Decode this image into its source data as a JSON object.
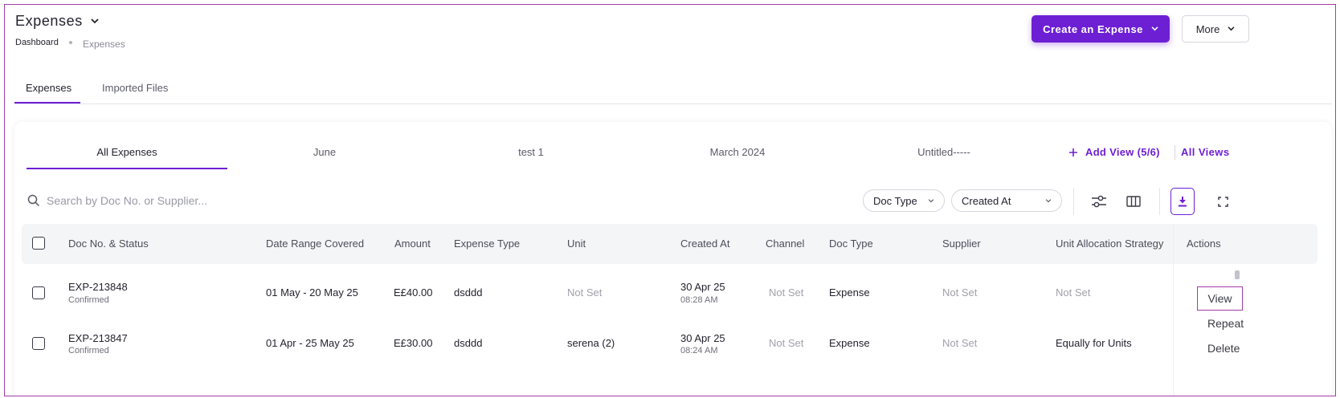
{
  "header": {
    "title": "Expenses",
    "breadcrumb": [
      "Dashboard",
      "Expenses"
    ],
    "create_button": "Create an Expense",
    "more_button": "More"
  },
  "tabs": [
    "Expenses",
    "Imported Files"
  ],
  "views": {
    "items": [
      "All Expenses",
      "June",
      "test 1",
      "March 2024",
      "Untitled-----"
    ],
    "add_view": "Add View (5/6)",
    "all_views": "All Views"
  },
  "search": {
    "placeholder": "Search by Doc No. or Supplier..."
  },
  "filters": {
    "doc_type": "Doc Type",
    "created_at": "Created At"
  },
  "colors": {
    "accent": "#6d1fd4",
    "highlight_border": "#a23ca8"
  },
  "table": {
    "columns": [
      "Doc No. & Status",
      "Date Range Covered",
      "Amount",
      "Expense Type",
      "Unit",
      "Created At",
      "Channel",
      "Doc Type",
      "Supplier",
      "Unit Allocation Strategy",
      "Actions"
    ],
    "rows": [
      {
        "doc_no": "EXP-213848",
        "status": "Confirmed",
        "date_range": "01 May - 20 May 25",
        "amount": "E£40.00",
        "expense_type": "dsddd",
        "unit": "Not Set",
        "created_date": "30 Apr 25",
        "created_time": "08:28 AM",
        "channel": "Not Set",
        "doc_type": "Expense",
        "supplier": "Not Set",
        "allocation": "Not Set"
      },
      {
        "doc_no": "EXP-213847",
        "status": "Confirmed",
        "date_range": "01 Apr - 25 May 25",
        "amount": "E£30.00",
        "expense_type": "dsddd",
        "unit": "serena (2)",
        "created_date": "30 Apr 25",
        "created_time": "08:24 AM",
        "channel": "Not Set",
        "doc_type": "Expense",
        "supplier": "Not Set",
        "allocation": "Equally for Units"
      }
    ]
  },
  "action_menu": [
    "View",
    "Repeat",
    "Delete"
  ]
}
